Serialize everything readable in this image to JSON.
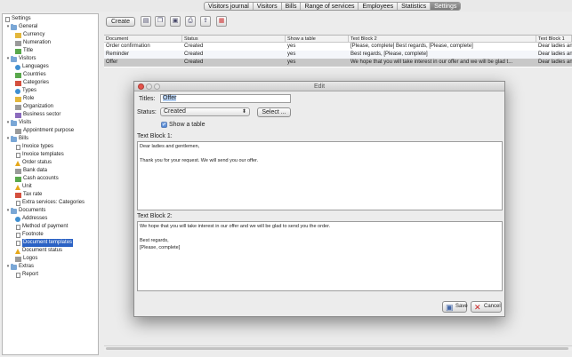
{
  "topbar": {
    "tabs": [
      {
        "label": "Visitors journal",
        "active": false
      },
      {
        "label": "Visitors",
        "active": false
      },
      {
        "label": "Bills",
        "active": false
      },
      {
        "label": "Range of services",
        "active": false
      },
      {
        "label": "Employees",
        "active": false
      },
      {
        "label": "Statistics",
        "active": false
      },
      {
        "label": "Settings",
        "active": true
      }
    ]
  },
  "tree": {
    "items": [
      {
        "label": "Settings",
        "level": 0,
        "icon": "doc",
        "toggle": ""
      },
      {
        "label": "General",
        "level": 1,
        "icon": "folder",
        "toggle": "▾"
      },
      {
        "label": "Currency",
        "level": 2,
        "icon": "yellow"
      },
      {
        "label": "Numeration",
        "level": 2,
        "icon": "gray"
      },
      {
        "label": "Title",
        "level": 2,
        "icon": "green"
      },
      {
        "label": "Visitors",
        "level": 1,
        "icon": "folder",
        "toggle": "▾"
      },
      {
        "label": "Languages",
        "level": 2,
        "icon": "circle"
      },
      {
        "label": "Countries",
        "level": 2,
        "icon": "green"
      },
      {
        "label": "Categories",
        "level": 2,
        "icon": "red"
      },
      {
        "label": "Types",
        "level": 2,
        "icon": "circle"
      },
      {
        "label": "Role",
        "level": 2,
        "icon": "yellow"
      },
      {
        "label": "Organization",
        "level": 2,
        "icon": "gray"
      },
      {
        "label": "Business sector",
        "level": 2,
        "icon": "purple"
      },
      {
        "label": "Visits",
        "level": 1,
        "icon": "folder",
        "toggle": "▾"
      },
      {
        "label": "Appointment purpose",
        "level": 2,
        "icon": "gray"
      },
      {
        "label": "Bills",
        "level": 1,
        "icon": "folder",
        "toggle": "▾"
      },
      {
        "label": "Invoice types",
        "level": 2,
        "icon": "doc"
      },
      {
        "label": "Invoice templates",
        "level": 2,
        "icon": "doc"
      },
      {
        "label": "Order status",
        "level": 2,
        "icon": "warn"
      },
      {
        "label": "Bank data",
        "level": 2,
        "icon": "gray"
      },
      {
        "label": "Cash accounts",
        "level": 2,
        "icon": "green"
      },
      {
        "label": "Unit",
        "level": 2,
        "icon": "warn"
      },
      {
        "label": "Tax rate",
        "level": 2,
        "icon": "red"
      },
      {
        "label": "Extra services: Categories",
        "level": 2,
        "icon": "doc"
      },
      {
        "label": "Documents",
        "level": 1,
        "icon": "folder",
        "toggle": "▾"
      },
      {
        "label": "Addresses",
        "level": 2,
        "icon": "circle"
      },
      {
        "label": "Method of payment",
        "level": 2,
        "icon": "doc"
      },
      {
        "label": "Footnote",
        "level": 2,
        "icon": "doc"
      },
      {
        "label": "Document templates",
        "level": 2,
        "icon": "doc",
        "selected": true
      },
      {
        "label": "Document status",
        "level": 2,
        "icon": "warn"
      },
      {
        "label": "Logos",
        "level": 2,
        "icon": "gray"
      },
      {
        "label": "Extras",
        "level": 1,
        "icon": "folder",
        "toggle": "▾"
      },
      {
        "label": "Report",
        "level": 2,
        "icon": "doc"
      }
    ]
  },
  "toolbar": {
    "create_label": "Create",
    "icons": [
      "new-document-icon",
      "copy-icon",
      "save-icon",
      "print-icon",
      "export-icon",
      "pdf-icon"
    ]
  },
  "grid": {
    "columns": [
      "Document",
      "Status",
      "Show a table",
      "Text Block 2",
      "Text Block 1"
    ],
    "rows": [
      [
        "Order confirmation",
        "Created",
        "yes",
        "[Please, complete]  Best regards, [Please, complete]",
        "Dear ladies and gentleme"
      ],
      [
        "Reminder",
        "Created",
        "yes",
        "Best regards, [Please, complete]",
        "Dear ladies and gentleme"
      ],
      [
        "Offer",
        "Created",
        "yes",
        "We hope that you will take interest in our offer and we will be glad t...",
        "Dear ladies and gentleme"
      ]
    ]
  },
  "modal": {
    "title": "Edit",
    "titles_label": "Titles:",
    "titles_value": "Offer",
    "status_label": "Status:",
    "status_value": "Created",
    "select_button": "Select ...",
    "show_table_label": "Show a table",
    "show_table_checked": "✓",
    "text_block1_label": "Text Block 1:",
    "text_block1_value": "Dear ladies and gentlemen,\n\nThank you for your request. We will send you our offer.",
    "text_block2_label": "Text Block 2:",
    "text_block2_value": "We hope that you will take interest in our offer and we will be glad to send you the order.\n\nBest regards,\n[Please, complete]",
    "save_label": "Save",
    "cancel_label": "Cancel"
  }
}
